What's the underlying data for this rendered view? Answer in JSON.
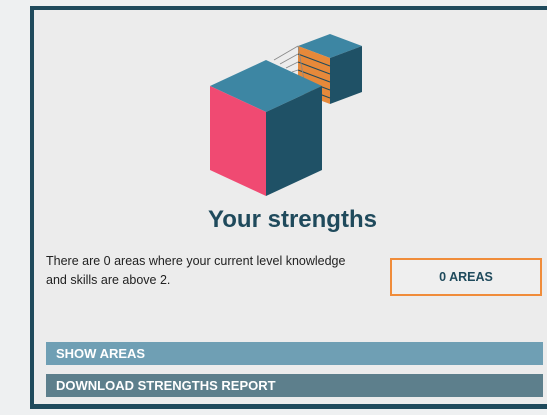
{
  "title": "Your strengths",
  "description": "There are 0 areas where your current level knowledge and skills are above 2.",
  "areas_badge": "0 AREAS",
  "buttons": {
    "show_areas": "SHOW AREAS",
    "download_report": "DOWNLOAD STRENGTHS REPORT"
  },
  "colors": {
    "primary_dark": "#1f4a5c",
    "accent_orange": "#f08c3a",
    "cube_pink": "#f04a72",
    "show_bar": "#6f9fb4",
    "download_bar": "#5d7f8c"
  },
  "icons": {
    "illustration": "cubes-strength-icon"
  }
}
